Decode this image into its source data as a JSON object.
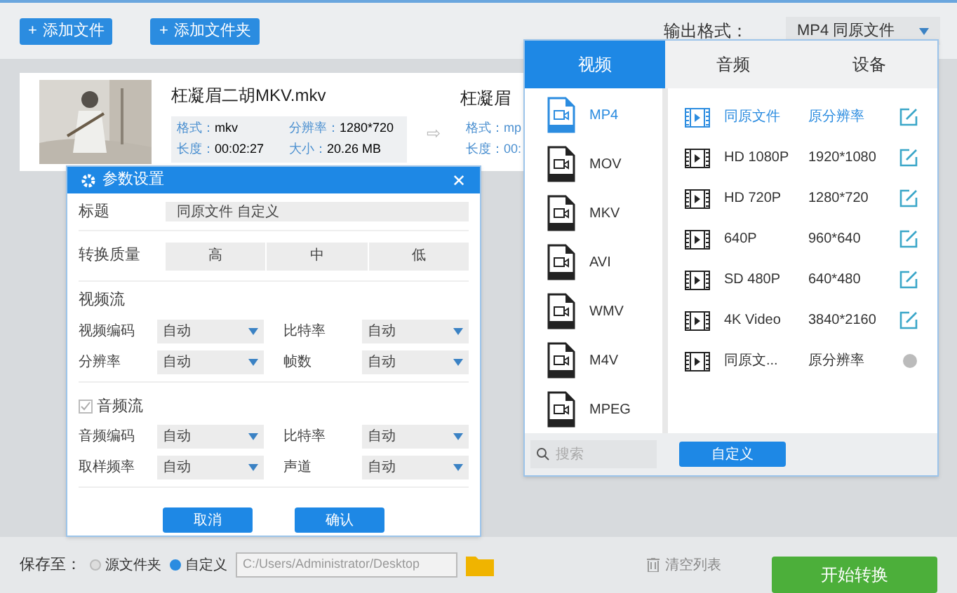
{
  "toolbar": {
    "buttons": [
      {
        "icon": "+",
        "label": "添加文件"
      },
      {
        "icon": "+",
        "label": "添加文件夹"
      }
    ],
    "output_format_label": "输出格式：",
    "output_format_value": "MP4  同原文件"
  },
  "files": [
    {
      "name": "枉凝眉二胡MKV.mkv",
      "format_label": "格式：",
      "format": "mkv",
      "resolution_label": "分辨率：",
      "resolution": "1280*720",
      "duration_label": "长度：",
      "duration": "00:02:27",
      "size_label": "大小：",
      "size": "20.26 MB"
    }
  ],
  "arrow": "⇨",
  "target": {
    "name": "枉凝眉",
    "format": "格式：mp",
    "duration": "长度：00:"
  },
  "dialog": {
    "title": "参数设置",
    "close": "✕",
    "title_label": "标题",
    "title_value": "同原文件 自定义",
    "quality_label": "转换质量",
    "quality": [
      {
        "label": "高",
        "selected": false
      },
      {
        "label": "中",
        "selected": false
      },
      {
        "label": "低",
        "selected": false
      }
    ],
    "video_header": "视频流",
    "video_rows": [
      [
        {
          "label": "视频编码",
          "value": "自动"
        },
        {
          "label": "比特率",
          "value": "自动"
        }
      ],
      [
        {
          "label": "分辨率",
          "value": "自动"
        },
        {
          "label": "帧数",
          "value": "自动"
        }
      ]
    ],
    "audio_header": "音频流",
    "audio_checked": true,
    "audio_rows": [
      [
        {
          "label": "音频编码",
          "value": "自动"
        },
        {
          "label": "比特率",
          "value": "自动"
        }
      ],
      [
        {
          "label": "取样频率",
          "value": "自动"
        },
        {
          "label": "声道",
          "value": "自动"
        }
      ]
    ],
    "buttons": [
      "取消",
      "确认"
    ]
  },
  "format_popup": {
    "tabs": [
      {
        "label": "视频",
        "selected": true
      },
      {
        "label": "音频",
        "selected": false
      },
      {
        "label": "设备",
        "selected": false
      }
    ],
    "formats": [
      {
        "label": "MP4",
        "selected": true
      },
      {
        "label": "MOV",
        "selected": false
      },
      {
        "label": "MKV",
        "selected": false
      },
      {
        "label": "AVI",
        "selected": false
      },
      {
        "label": "WMV",
        "selected": false
      },
      {
        "label": "M4V",
        "selected": false
      },
      {
        "label": "MPEG",
        "selected": false
      }
    ],
    "presets": [
      {
        "name": "同原文件",
        "resolution": "原分辨率",
        "selected": true,
        "kind": "editable"
      },
      {
        "name": "HD 1080P",
        "resolution": "1920*1080",
        "selected": false,
        "kind": "editable"
      },
      {
        "name": "HD 720P",
        "resolution": "1280*720",
        "selected": false,
        "kind": "editable"
      },
      {
        "name": "640P",
        "resolution": "960*640",
        "selected": false,
        "kind": "editable"
      },
      {
        "name": "SD 480P",
        "resolution": "640*480",
        "selected": false,
        "kind": "editable"
      },
      {
        "name": "4K Video",
        "resolution": "3840*2160",
        "selected": false,
        "kind": "editable"
      },
      {
        "name": "同原文...",
        "resolution": "原分辨率",
        "selected": false,
        "kind": "fixed"
      }
    ],
    "search_placeholder": "搜索",
    "custom_button": "自定义"
  },
  "bottom": {
    "save_label": "保存至：",
    "options": [
      {
        "label": "源文件夹",
        "selected": false
      },
      {
        "label": "自定义",
        "selected": true
      }
    ],
    "path": "C:/Users/Administrator/Desktop",
    "clear": "清空列表",
    "start": "开始转换"
  }
}
